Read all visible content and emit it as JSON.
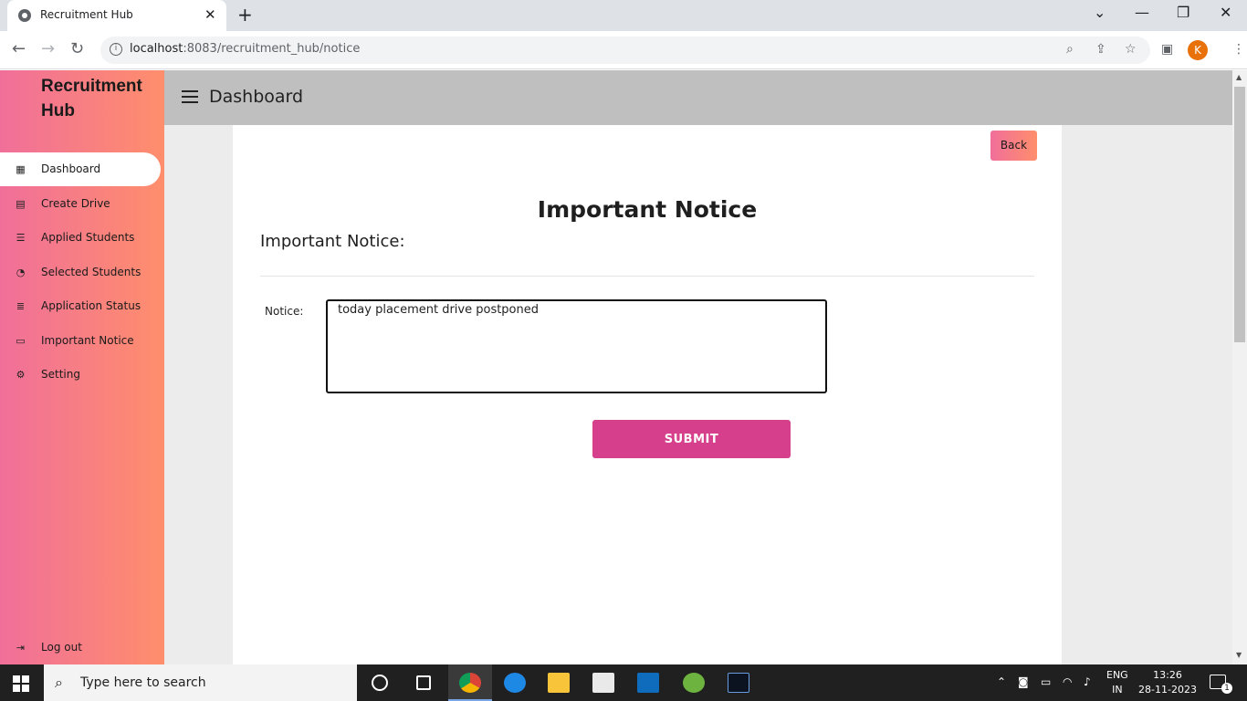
{
  "browser": {
    "tab_title": "Recruitment Hub",
    "tab_close": "✕",
    "new_tab": "+",
    "url_host": "localhost",
    "url_rest": ":8083/recruitment_hub/notice",
    "profile_initial": "K",
    "window_controls": {
      "dropdown": "⌄",
      "minimize": "—",
      "restore": "❐",
      "close": "✕"
    }
  },
  "sidebar": {
    "brand": "Recruitment Hub",
    "items": [
      {
        "label": "Dashboard",
        "icon": "grid-icon",
        "glyph": "▦"
      },
      {
        "label": "Create Drive",
        "icon": "archive-icon",
        "glyph": "▤"
      },
      {
        "label": "Applied Students",
        "icon": "list-icon",
        "glyph": "☰"
      },
      {
        "label": "Selected Students",
        "icon": "pie-chart-icon",
        "glyph": "◔"
      },
      {
        "label": "Application Status",
        "icon": "database-icon",
        "glyph": "≣"
      },
      {
        "label": "Important Notice",
        "icon": "comment-icon",
        "glyph": "▭"
      },
      {
        "label": "Setting",
        "icon": "gear-icon",
        "glyph": "⚙"
      }
    ],
    "logout": {
      "label": "Log out",
      "icon": "logout-icon",
      "glyph": "⇥"
    },
    "active_index": 0,
    "gradient": [
      "#f06f9a",
      "#ff8e6c"
    ]
  },
  "header": {
    "title": "Dashboard"
  },
  "main": {
    "back_label": "Back",
    "page_title": "Important Notice",
    "subtitle": "Important Notice:",
    "notice_label": "Notice:",
    "notice_value": "today placement drive postponed",
    "submit_label": "SUBMIT",
    "submit_color": "#d63f8c"
  },
  "taskbar": {
    "search_placeholder": "Type here to search",
    "lang_top": "ENG",
    "lang_bottom": "IN",
    "time": "13:26",
    "date": "28-11-2023",
    "notification_count": "1"
  }
}
